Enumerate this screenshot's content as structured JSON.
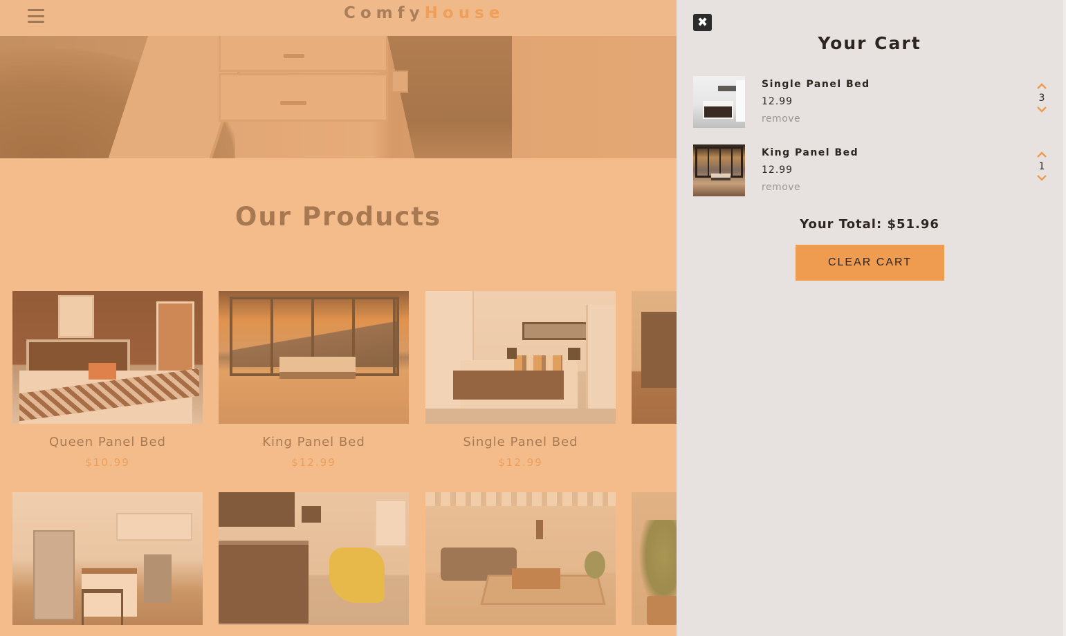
{
  "navbar": {
    "menu_icon": "hamburger-menu-icon",
    "logo_part1": "Comfy",
    "logo_part2": "House",
    "accent_color": "#ee9b52"
  },
  "products_section": {
    "title": "Our Products",
    "products": [
      {
        "name": "Queen Panel Bed",
        "price": "$10.99"
      },
      {
        "name": "King Panel Bed",
        "price": "$12.99"
      },
      {
        "name": "Single Panel Bed",
        "price": "$12.99"
      }
    ]
  },
  "cart": {
    "close_icon": "close-icon",
    "title": "Your Cart",
    "items": [
      {
        "name": "Single Panel Bed",
        "price": "12.99",
        "remove_label": "remove",
        "amount": "3"
      },
      {
        "name": "King Panel Bed",
        "price": "12.99",
        "remove_label": "remove",
        "amount": "1"
      }
    ],
    "total_label": "Your Total: $51.96",
    "clear_label": "CLEAR CART",
    "button_color": "#f09c50"
  }
}
